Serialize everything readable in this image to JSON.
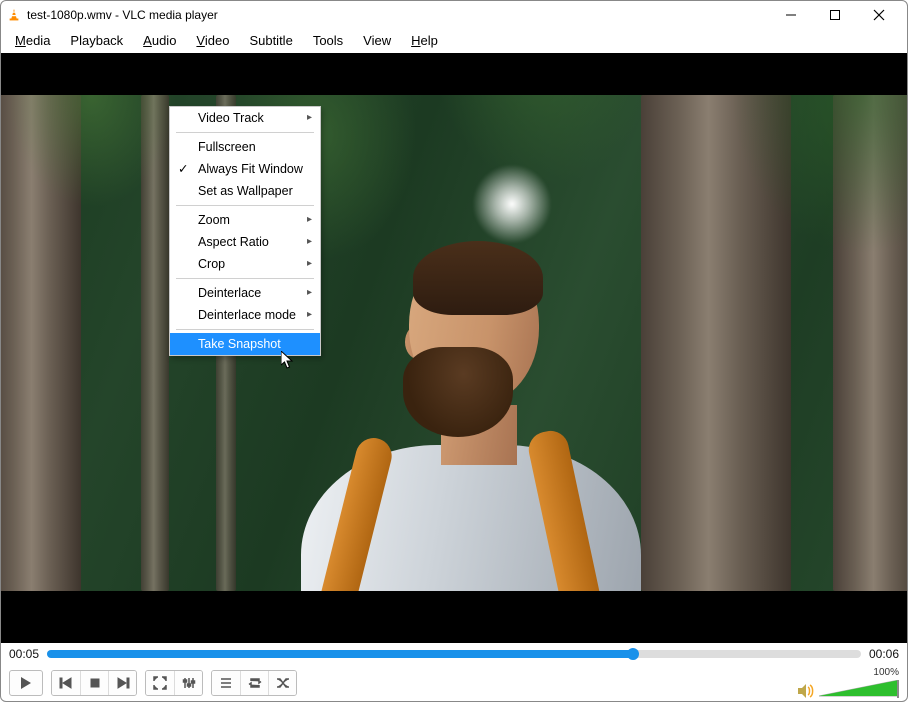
{
  "window": {
    "title": "test-1080p.wmv - VLC media player"
  },
  "menubar": {
    "media": {
      "label": "Media",
      "ul": "M",
      "rest": "edia"
    },
    "playback": {
      "label": "Playback",
      "ul": "",
      "rest": "Playback"
    },
    "audio": {
      "label": "Audio",
      "ul": "A",
      "rest": "udio"
    },
    "video": {
      "label": "Video",
      "ul": "V",
      "rest": "ideo"
    },
    "subtitle": {
      "label": "Subtitle",
      "ul": "",
      "rest": "Subtitle"
    },
    "tools": {
      "label": "Tools",
      "ul": "",
      "rest": "Tools"
    },
    "view": {
      "label": "View",
      "ul": "",
      "rest": "View"
    },
    "help": {
      "label": "Help",
      "ul": "H",
      "rest": "elp"
    }
  },
  "video_menu": {
    "video_track": {
      "pre": "Video ",
      "ul": "T",
      "post": "rack",
      "submenu": true
    },
    "fullscreen": {
      "pre": "",
      "ul": "F",
      "post": "ullscreen"
    },
    "always_fit_window": {
      "pre": "Always Fit ",
      "ul": "W",
      "post": "indow",
      "checked": true
    },
    "set_as_wallpaper": {
      "pre": "Set as Wa",
      "ul": "l",
      "post": "lpaper"
    },
    "zoom": {
      "pre": "",
      "ul": "Z",
      "post": "oom",
      "submenu": true
    },
    "aspect_ratio": {
      "pre": "",
      "ul": "A",
      "post": "spect Ratio",
      "submenu": true
    },
    "crop": {
      "pre": "",
      "ul": "C",
      "post": "rop",
      "submenu": true
    },
    "deinterlace": {
      "pre": "",
      "ul": "D",
      "post": "einterlace",
      "submenu": true
    },
    "deinterlace_mode": {
      "pre": "Deinterlace ",
      "ul": "m",
      "post": "ode",
      "submenu": true
    },
    "take_snapshot": {
      "pre": "Take Snap",
      "ul": "s",
      "post": "hot",
      "highlighted": true
    }
  },
  "playback": {
    "current_time": "00:05",
    "total_time": "00:06",
    "progress_pct": 72
  },
  "volume": {
    "percent_label": "100%",
    "level_pct": 100
  }
}
